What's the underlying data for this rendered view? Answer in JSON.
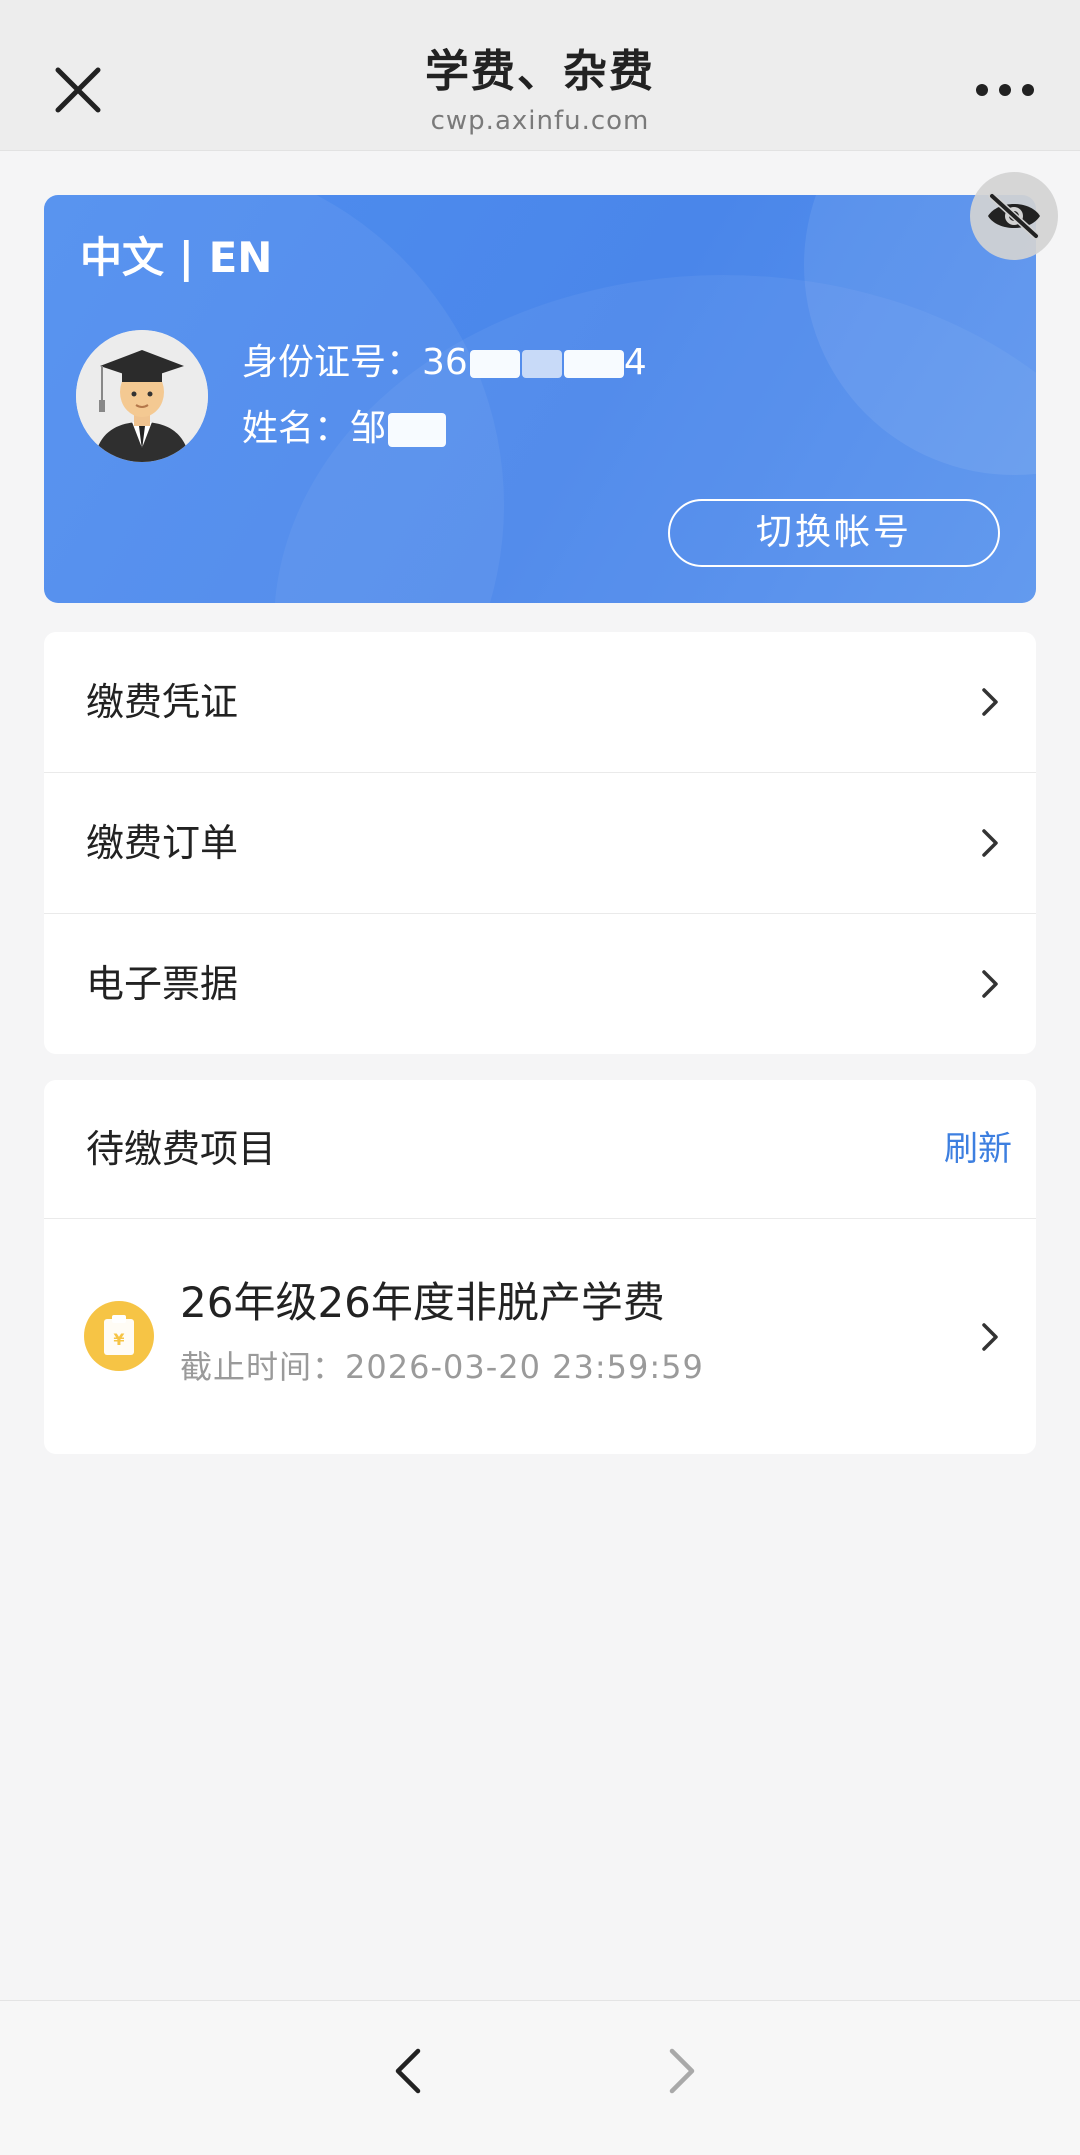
{
  "nav": {
    "title": "学费、杂费",
    "subtitle": "cwp.axinfu.com",
    "close_icon": "close-icon",
    "more_icon": "more-icon"
  },
  "card": {
    "language_toggle": "中文 | EN",
    "id_label": "身份证号：",
    "id_value_visible": "36",
    "id_tail": "4",
    "name_label": "姓名：",
    "name_value_visible": "邹",
    "switch_button": "切换帐号",
    "hide_icon": "eye-off-icon",
    "avatar_icon": "graduate-avatar-icon",
    "colors": {
      "card_bg": "#4a86ea",
      "text": "#ffffff"
    }
  },
  "menu": {
    "items": [
      {
        "label": "缴费凭证"
      },
      {
        "label": "缴费订单"
      },
      {
        "label": "电子票据"
      }
    ]
  },
  "pending": {
    "title": "待缴费项目",
    "refresh": "刷新",
    "bills": [
      {
        "name": "26年级26年度非脱产学费",
        "deadline": "截止时间：2026-03-20 23:59:59",
        "icon": "payment-bill-icon"
      }
    ],
    "colors": {
      "refresh": "#3d7fe0",
      "bill_icon_bg": "#f6c445"
    }
  },
  "toolbar": {
    "back_icon": "back-arrow-icon",
    "forward_icon": "forward-arrow-icon"
  }
}
